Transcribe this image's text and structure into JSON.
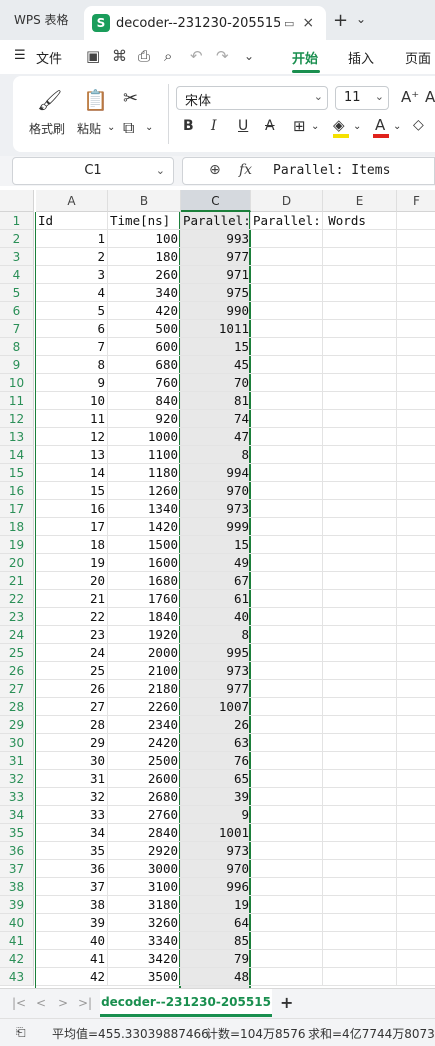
{
  "titlebar": {
    "app_tab": "WPS 表格",
    "doc_tab": "decoder--231230-205515.csv",
    "close": "×",
    "new_tab": "+",
    "more": "⌄"
  },
  "menubar": {
    "hamburger": "☰",
    "file": "文件",
    "tabs": [
      "开始",
      "插入",
      "页面"
    ]
  },
  "ribbon": {
    "format_painter": "格式刷",
    "paste": "粘贴",
    "font_name": "宋体",
    "font_size": "11",
    "bold": "B",
    "italic": "I",
    "underline": "U",
    "strike": "A",
    "grow_font": "A⁺",
    "font_color_letter": "A",
    "fill_color": "#f5e100",
    "font_color": "#e0221b"
  },
  "formula_bar": {
    "cell_ref": "C1",
    "fx": "fx",
    "content": "Parallel: Items"
  },
  "columns": [
    "A",
    "B",
    "C",
    "D",
    "E",
    "F"
  ],
  "header_row": {
    "row": "1",
    "a": "Id",
    "b": "Time[ns]",
    "c": "Parallel:",
    "d": "Parallel: Words",
    "e": ""
  },
  "rows": [
    {
      "row": "2",
      "id": "1",
      "time": "100",
      "items": "993"
    },
    {
      "row": "3",
      "id": "2",
      "time": "180",
      "items": "977"
    },
    {
      "row": "4",
      "id": "3",
      "time": "260",
      "items": "971"
    },
    {
      "row": "5",
      "id": "4",
      "time": "340",
      "items": "975"
    },
    {
      "row": "6",
      "id": "5",
      "time": "420",
      "items": "990"
    },
    {
      "row": "7",
      "id": "6",
      "time": "500",
      "items": "1011"
    },
    {
      "row": "8",
      "id": "7",
      "time": "600",
      "items": "15"
    },
    {
      "row": "9",
      "id": "8",
      "time": "680",
      "items": "45"
    },
    {
      "row": "10",
      "id": "9",
      "time": "760",
      "items": "70"
    },
    {
      "row": "11",
      "id": "10",
      "time": "840",
      "items": "81"
    },
    {
      "row": "12",
      "id": "11",
      "time": "920",
      "items": "74"
    },
    {
      "row": "13",
      "id": "12",
      "time": "1000",
      "items": "47"
    },
    {
      "row": "14",
      "id": "13",
      "time": "1100",
      "items": "8"
    },
    {
      "row": "15",
      "id": "14",
      "time": "1180",
      "items": "994"
    },
    {
      "row": "16",
      "id": "15",
      "time": "1260",
      "items": "970"
    },
    {
      "row": "17",
      "id": "16",
      "time": "1340",
      "items": "973"
    },
    {
      "row": "18",
      "id": "17",
      "time": "1420",
      "items": "999"
    },
    {
      "row": "19",
      "id": "18",
      "time": "1500",
      "items": "15"
    },
    {
      "row": "20",
      "id": "19",
      "time": "1600",
      "items": "49"
    },
    {
      "row": "21",
      "id": "20",
      "time": "1680",
      "items": "67"
    },
    {
      "row": "22",
      "id": "21",
      "time": "1760",
      "items": "61"
    },
    {
      "row": "23",
      "id": "22",
      "time": "1840",
      "items": "40"
    },
    {
      "row": "24",
      "id": "23",
      "time": "1920",
      "items": "8"
    },
    {
      "row": "25",
      "id": "24",
      "time": "2000",
      "items": "995"
    },
    {
      "row": "26",
      "id": "25",
      "time": "2100",
      "items": "973"
    },
    {
      "row": "27",
      "id": "26",
      "time": "2180",
      "items": "977"
    },
    {
      "row": "28",
      "id": "27",
      "time": "2260",
      "items": "1007"
    },
    {
      "row": "29",
      "id": "28",
      "time": "2340",
      "items": "26"
    },
    {
      "row": "30",
      "id": "29",
      "time": "2420",
      "items": "63"
    },
    {
      "row": "31",
      "id": "30",
      "time": "2500",
      "items": "76"
    },
    {
      "row": "32",
      "id": "31",
      "time": "2600",
      "items": "65"
    },
    {
      "row": "33",
      "id": "32",
      "time": "2680",
      "items": "39"
    },
    {
      "row": "34",
      "id": "33",
      "time": "2760",
      "items": "9"
    },
    {
      "row": "35",
      "id": "34",
      "time": "2840",
      "items": "1001"
    },
    {
      "row": "36",
      "id": "35",
      "time": "2920",
      "items": "973"
    },
    {
      "row": "37",
      "id": "36",
      "time": "3000",
      "items": "970"
    },
    {
      "row": "38",
      "id": "37",
      "time": "3100",
      "items": "996"
    },
    {
      "row": "39",
      "id": "38",
      "time": "3180",
      "items": "19"
    },
    {
      "row": "40",
      "id": "39",
      "time": "3260",
      "items": "64"
    },
    {
      "row": "41",
      "id": "40",
      "time": "3340",
      "items": "85"
    },
    {
      "row": "42",
      "id": "41",
      "time": "3420",
      "items": "79"
    },
    {
      "row": "43",
      "id": "42",
      "time": "3500",
      "items": "48"
    }
  ],
  "sheetbar": {
    "first": "|<",
    "prev": "<",
    "next": ">",
    "last": ">|",
    "sheet_name": "decoder--231230-205515",
    "add": "+"
  },
  "status": {
    "average": "平均值=455.33039887466",
    "count": "计数=104万8576",
    "sum": "求和=4亿7744万8073"
  }
}
